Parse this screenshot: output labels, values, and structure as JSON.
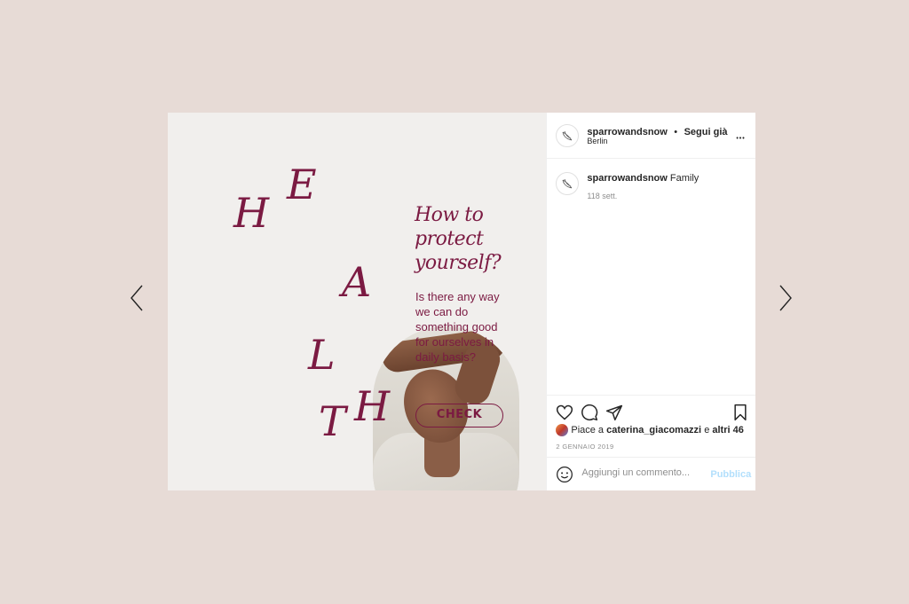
{
  "nav": {
    "prev": "chevron-left",
    "next": "chevron-right"
  },
  "post_image": {
    "letters": [
      "H",
      "E",
      "A",
      "L",
      "T",
      "H"
    ],
    "headline": "How to protect yourself?",
    "body": "Is there any way we can do something good for ourselves in daily basis?",
    "button": "CHECK",
    "accent": "#7b1a42"
  },
  "header": {
    "username": "sparrowandsnow",
    "separator": "•",
    "follow_label": "Segui già",
    "location": "Berlin",
    "more": "•••"
  },
  "caption": {
    "username": "sparrowandsnow",
    "text": "Family",
    "time": "118 sett."
  },
  "engagement": {
    "likes_prefix": "Piace a",
    "liked_by": "caterina_giacomazzi",
    "likes_mid": "e",
    "likes_others": "altri 46",
    "date": "2 GENNAIO 2019"
  },
  "comment": {
    "placeholder": "Aggiungi un commento...",
    "publish": "Pubblica"
  }
}
